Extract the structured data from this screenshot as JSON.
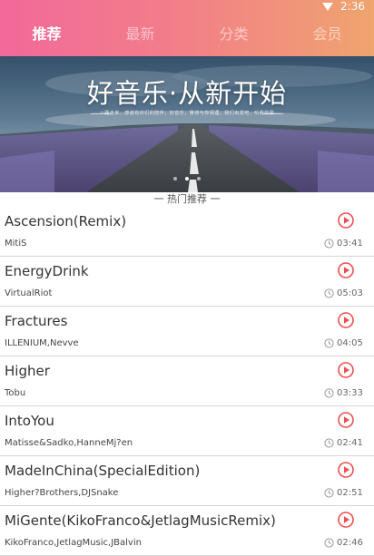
{
  "status_bar": {
    "time": "2:36",
    "icons": [
      "wifi-icon"
    ]
  },
  "tabs": [
    {
      "label": "推荐",
      "active": true
    },
    {
      "label": "最新",
      "active": false
    },
    {
      "label": "分类",
      "active": false
    },
    {
      "label": "会员",
      "active": false
    }
  ],
  "banner": {
    "title": "好音乐·从新开始",
    "subtitle": "一路走来，感谢有你们的陪伴；好音乐，等待与你相遇；我们出发吧，听我的歌",
    "slide_count": 3,
    "active_slide": 1
  },
  "section_title": "一 热门推荐 一",
  "colors": {
    "accent": "#f04f4f",
    "header_start": "#f2699a",
    "header_end": "#f0a46e"
  },
  "songs": [
    {
      "title": "Ascension(Remix)",
      "artist": "MitiS",
      "duration": "03:41"
    },
    {
      "title": "EnergyDrink",
      "artist": "VirtualRiot",
      "duration": "05:03"
    },
    {
      "title": "Fractures",
      "artist": "ILLENIUM,Nevve",
      "duration": "04:05"
    },
    {
      "title": "Higher",
      "artist": "Tobu",
      "duration": "03:33"
    },
    {
      "title": "IntoYou",
      "artist": "Matisse&Sadko,HanneMj?en",
      "duration": "02:41"
    },
    {
      "title": "MadeInChina(SpecialEdition)",
      "artist": "Higher?Brothers,DJSnake",
      "duration": "02:51"
    },
    {
      "title": "MiGente(KikoFranco&JetlagMusicRemix)",
      "artist": "KikoFranco,JetlagMusic,JBalvin",
      "duration": "02:46"
    }
  ]
}
